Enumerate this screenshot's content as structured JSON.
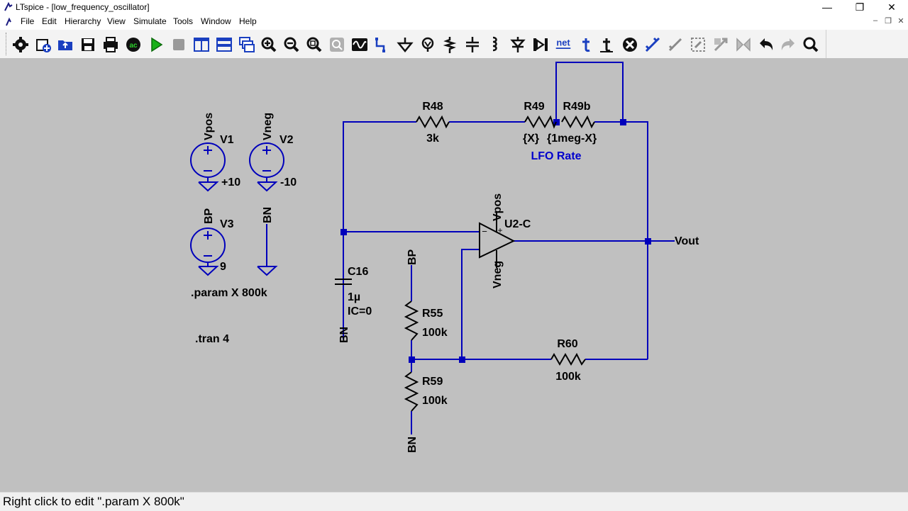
{
  "window": {
    "title": "LTspice - [low_frequency_oscillator]",
    "controls": [
      "—",
      "❐",
      "✕"
    ]
  },
  "menu": {
    "items": [
      "File",
      "Edit",
      "Hierarchy",
      "View",
      "Simulate",
      "Tools",
      "Window",
      "Help"
    ],
    "mdi_controls": [
      "–",
      "❐",
      "✕"
    ]
  },
  "toolbar": {
    "buttons": [
      "settings-icon",
      "new-schematic-icon",
      "open-icon",
      "save-icon",
      "print-icon",
      "ac-analysis-icon",
      "run-icon",
      "halt-icon",
      "tile-vertical-icon",
      "tile-horizontal-icon",
      "cascade-icon",
      "zoom-in-icon",
      "zoom-out-icon",
      "zoom-fit-icon",
      "zoom-area-icon",
      "waveform-icon",
      "draw-wire-icon",
      "ground-icon",
      "label-net-icon",
      "resistor-icon",
      "capacitor-icon",
      "inductor-icon",
      "diode-icon",
      "component-icon",
      "spice-directive-icon",
      "text-icon",
      "move-icon",
      "delete-icon",
      "duplicate-icon",
      "drag-icon",
      "rotate-icon",
      "mirror-icon",
      "flip-icon",
      "undo-icon",
      "redo-icon",
      "find-icon"
    ],
    "net_label": "net"
  },
  "schematic": {
    "sources": {
      "v1": {
        "name": "V1",
        "net": "Vpos",
        "value": "+10"
      },
      "v2": {
        "name": "V2",
        "net": "Vneg",
        "value": "-10"
      },
      "v3": {
        "name": "V3",
        "net": "BP",
        "value": "9"
      },
      "bn_ground": {
        "net": "BN"
      }
    },
    "directives": {
      "param": ".param X 800k",
      "tran": ".tran 4"
    },
    "resistors": {
      "r48": {
        "name": "R48",
        "value": "3k"
      },
      "r49": {
        "name": "R49",
        "value": "{X}"
      },
      "r49b": {
        "name": "R49b",
        "value": "{1meg-X}"
      },
      "r55": {
        "name": "R55",
        "value": "100k"
      },
      "r59": {
        "name": "R59",
        "value": "100k"
      },
      "r60": {
        "name": "R60",
        "value": "100k"
      }
    },
    "pot_label": "LFO Rate",
    "capacitor": {
      "name": "C16",
      "value": "1µ",
      "ic": "IC=0",
      "net": "BN"
    },
    "opamp": {
      "name": "U2-C",
      "pos_rail": "Vpos",
      "neg_rail": "Vneg",
      "plus": "+",
      "minus": "−"
    },
    "nets": {
      "bp": "BP",
      "bn": "BN",
      "out": "Vout"
    },
    "colors": {
      "wire": "#0000bb",
      "label_blue": "#0000cc",
      "canvas": "#c0c0c0"
    }
  },
  "status": {
    "text": "Right click to edit \".param X 800k\""
  }
}
